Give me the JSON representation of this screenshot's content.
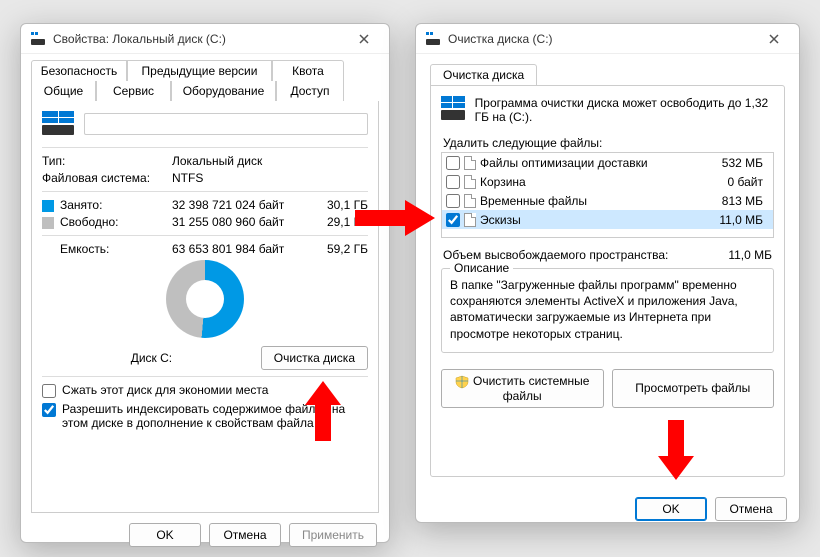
{
  "left": {
    "title": "Свойства: Локальный диск (C:)",
    "tabs": {
      "security": "Безопасность",
      "prev_versions": "Предыдущие версии",
      "quota": "Квота",
      "general": "Общие",
      "service": "Сервис",
      "equipment": "Оборудование",
      "access": "Доступ"
    },
    "type_label": "Тип:",
    "type_value": "Локальный диск",
    "fs_label": "Файловая система:",
    "fs_value": "NTFS",
    "used_label": "Занято:",
    "used_bytes": "32 398 721 024 байт",
    "used_human": "30,1 ГБ",
    "free_label": "Свободно:",
    "free_bytes": "31 255 080 960 байт",
    "free_human": "29,1 ГБ",
    "capacity_label": "Емкость:",
    "capacity_bytes": "63 653 801 984 байт",
    "capacity_human": "59,2 ГБ",
    "disk_label": "Диск C:",
    "cleanup_btn": "Очистка диска",
    "compress_cb": "Сжать этот диск для экономии места",
    "index_cb": "Разрешить индексировать содержимое файлов на этом диске в дополнение к свойствам файла",
    "ok": "OK",
    "cancel": "Отмена",
    "apply": "Применить"
  },
  "right": {
    "title": "Очистка диска  (C:)",
    "tab": "Очистка диска",
    "info": "Программа очистки диска может освободить до 1,32 ГБ на  (C:).",
    "delete_label": "Удалить следующие файлы:",
    "files": [
      {
        "name": "Файлы оптимизации доставки",
        "size": "532 МБ",
        "checked": false
      },
      {
        "name": "Корзина",
        "size": "0 байт",
        "checked": false
      },
      {
        "name": "Временные файлы",
        "size": "813 МБ",
        "checked": false
      },
      {
        "name": "Эскизы",
        "size": "11,0 МБ",
        "checked": true
      }
    ],
    "free_space_label": "Объем высвобождаемого пространства:",
    "free_space_value": "11,0 МБ",
    "desc_legend": "Описание",
    "desc_text": "В папке \"Загруженные файлы программ\" временно сохраняются элементы ActiveX и приложения Java, автоматически загружаемые из Интернета при просмотре некоторых страниц.",
    "clean_sys": "Очистить системные файлы",
    "view_files": "Просмотреть файлы",
    "ok": "OK",
    "cancel": "Отмена"
  }
}
